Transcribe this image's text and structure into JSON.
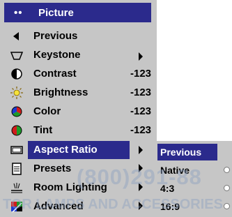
{
  "menu": {
    "title": {
      "label": "Picture",
      "dots": "••"
    },
    "items": [
      {
        "label": "Previous",
        "value": "",
        "icon": "triangle-left-icon"
      },
      {
        "label": "Keystone",
        "value": "",
        "icon": "keystone-icon"
      },
      {
        "label": "Contrast",
        "value": "-123",
        "icon": "contrast-icon"
      },
      {
        "label": "Brightness",
        "value": "-123",
        "icon": "brightness-icon"
      },
      {
        "label": "Color",
        "value": "-123",
        "icon": "color-wheel-icon"
      },
      {
        "label": "Tint",
        "value": "-123",
        "icon": "tint-icon"
      },
      {
        "label": "Aspect Ratio",
        "value": "",
        "icon": "aspect-ratio-icon"
      },
      {
        "label": "Presets",
        "value": "",
        "icon": "presets-icon"
      },
      {
        "label": "Room Lighting",
        "value": "",
        "icon": "room-lighting-icon"
      },
      {
        "label": "Advanced",
        "value": "",
        "icon": "advanced-icon"
      }
    ],
    "selected_index": 6
  },
  "submenu": {
    "items": [
      {
        "label": "Previous"
      },
      {
        "label": "Native"
      },
      {
        "label": "4:3"
      },
      {
        "label": "16:9"
      }
    ],
    "selected_index": 0
  },
  "watermark": {
    "phone": "(800)291-88",
    "line2": "TOR LAMPS AND ACCESSORIES"
  },
  "colors": {
    "accent": "#2b2a8c",
    "panel": "#c6c6c6",
    "text": "#000000"
  }
}
